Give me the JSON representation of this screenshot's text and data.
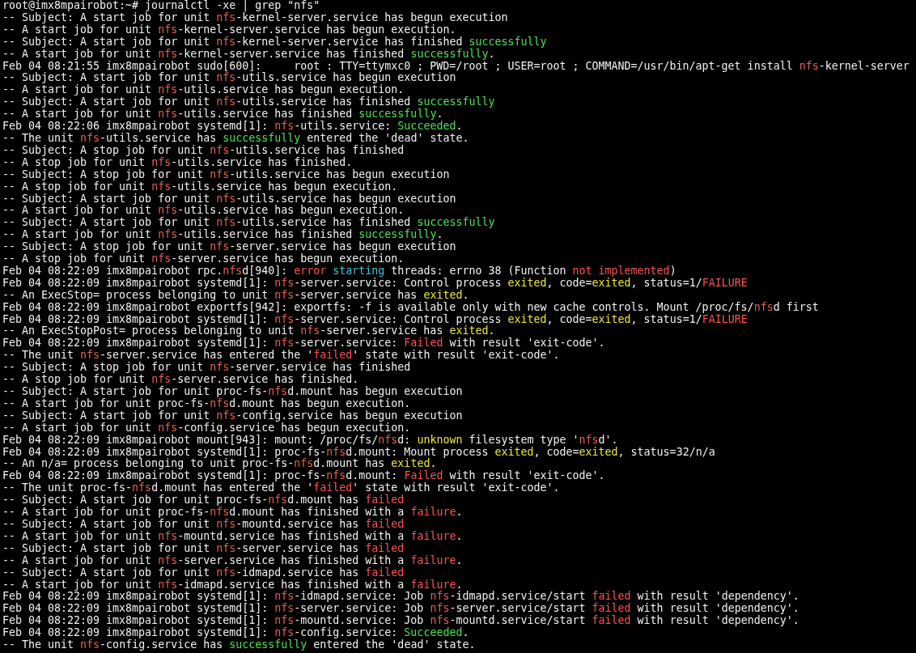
{
  "terminal": {
    "lines": [
      {
        "segments": [
          {
            "kind": "plain",
            "text": "root@imx8mpairobot:~# journalctl -xe | grep \"nfs\""
          }
        ]
      },
      {
        "segments": [
          {
            "kind": "plain",
            "text": "-- Subject: A start job for unit "
          },
          {
            "kind": "match",
            "text": "nfs"
          },
          {
            "kind": "plain",
            "text": "-kernel-server.service has begun execution"
          }
        ]
      },
      {
        "segments": [
          {
            "kind": "plain",
            "text": "-- A start job for unit "
          },
          {
            "kind": "match",
            "text": "nfs"
          },
          {
            "kind": "plain",
            "text": "-kernel-server.service has begun execution."
          }
        ]
      },
      {
        "segments": [
          {
            "kind": "plain",
            "text": "-- Subject: A start job for unit "
          },
          {
            "kind": "match",
            "text": "nfs"
          },
          {
            "kind": "plain",
            "text": "-kernel-server.service has finished "
          },
          {
            "kind": "good",
            "text": "successfully"
          }
        ]
      },
      {
        "segments": [
          {
            "kind": "plain",
            "text": "-- A start job for unit "
          },
          {
            "kind": "match",
            "text": "nfs"
          },
          {
            "kind": "plain",
            "text": "-kernel-server.service has finished "
          },
          {
            "kind": "good",
            "text": "successfully"
          },
          {
            "kind": "plain",
            "text": "."
          }
        ]
      },
      {
        "segments": [
          {
            "kind": "plain",
            "text": "Feb 04 08:21:55 imx8mpairobot sudo[600]:     root : TTY=ttymxc0 ; PWD=/root ; USER=root ; COMMAND=/usr/bin/apt-get install "
          },
          {
            "kind": "match",
            "text": "nfs"
          },
          {
            "kind": "plain",
            "text": "-kernel-server"
          }
        ]
      },
      {
        "segments": [
          {
            "kind": "plain",
            "text": "-- Subject: A start job for unit "
          },
          {
            "kind": "match",
            "text": "nfs"
          },
          {
            "kind": "plain",
            "text": "-utils.service has begun execution"
          }
        ]
      },
      {
        "segments": [
          {
            "kind": "plain",
            "text": "-- A start job for unit "
          },
          {
            "kind": "match",
            "text": "nfs"
          },
          {
            "kind": "plain",
            "text": "-utils.service has begun execution."
          }
        ]
      },
      {
        "segments": [
          {
            "kind": "plain",
            "text": "-- Subject: A start job for unit "
          },
          {
            "kind": "match",
            "text": "nfs"
          },
          {
            "kind": "plain",
            "text": "-utils.service has finished "
          },
          {
            "kind": "good",
            "text": "successfully"
          }
        ]
      },
      {
        "segments": [
          {
            "kind": "plain",
            "text": "-- A start job for unit "
          },
          {
            "kind": "match",
            "text": "nfs"
          },
          {
            "kind": "plain",
            "text": "-utils.service has finished "
          },
          {
            "kind": "good",
            "text": "successfully"
          },
          {
            "kind": "plain",
            "text": "."
          }
        ]
      },
      {
        "segments": [
          {
            "kind": "plain",
            "text": "Feb 04 08:22:06 imx8mpairobot systemd[1]: "
          },
          {
            "kind": "match",
            "text": "nfs"
          },
          {
            "kind": "plain",
            "text": "-utils.service: "
          },
          {
            "kind": "good",
            "text": "Succeeded"
          },
          {
            "kind": "plain",
            "text": "."
          }
        ]
      },
      {
        "segments": [
          {
            "kind": "plain",
            "text": "-- The unit "
          },
          {
            "kind": "match",
            "text": "nfs"
          },
          {
            "kind": "plain",
            "text": "-utils.service has "
          },
          {
            "kind": "good",
            "text": "successfully"
          },
          {
            "kind": "plain",
            "text": " entered the 'dead' state."
          }
        ]
      },
      {
        "segments": [
          {
            "kind": "plain",
            "text": "-- Subject: A stop job for unit "
          },
          {
            "kind": "match",
            "text": "nfs"
          },
          {
            "kind": "plain",
            "text": "-utils.service has finished"
          }
        ]
      },
      {
        "segments": [
          {
            "kind": "plain",
            "text": "-- A stop job for unit "
          },
          {
            "kind": "match",
            "text": "nfs"
          },
          {
            "kind": "plain",
            "text": "-utils.service has finished."
          }
        ]
      },
      {
        "segments": [
          {
            "kind": "plain",
            "text": "-- Subject: A stop job for unit "
          },
          {
            "kind": "match",
            "text": "nfs"
          },
          {
            "kind": "plain",
            "text": "-utils.service has begun execution"
          }
        ]
      },
      {
        "segments": [
          {
            "kind": "plain",
            "text": "-- A stop job for unit "
          },
          {
            "kind": "match",
            "text": "nfs"
          },
          {
            "kind": "plain",
            "text": "-utils.service has begun execution."
          }
        ]
      },
      {
        "segments": [
          {
            "kind": "plain",
            "text": "-- Subject: A start job for unit "
          },
          {
            "kind": "match",
            "text": "nfs"
          },
          {
            "kind": "plain",
            "text": "-utils.service has begun execution"
          }
        ]
      },
      {
        "segments": [
          {
            "kind": "plain",
            "text": "-- A start job for unit "
          },
          {
            "kind": "match",
            "text": "nfs"
          },
          {
            "kind": "plain",
            "text": "-utils.service has begun execution."
          }
        ]
      },
      {
        "segments": [
          {
            "kind": "plain",
            "text": "-- Subject: A start job for unit "
          },
          {
            "kind": "match",
            "text": "nfs"
          },
          {
            "kind": "plain",
            "text": "-utils.service has finished "
          },
          {
            "kind": "good",
            "text": "successfully"
          }
        ]
      },
      {
        "segments": [
          {
            "kind": "plain",
            "text": "-- A start job for unit "
          },
          {
            "kind": "match",
            "text": "nfs"
          },
          {
            "kind": "plain",
            "text": "-utils.service has finished "
          },
          {
            "kind": "good",
            "text": "successfully"
          },
          {
            "kind": "plain",
            "text": "."
          }
        ]
      },
      {
        "segments": [
          {
            "kind": "plain",
            "text": "-- Subject: A stop job for unit "
          },
          {
            "kind": "match",
            "text": "nfs"
          },
          {
            "kind": "plain",
            "text": "-server.service has begun execution"
          }
        ]
      },
      {
        "segments": [
          {
            "kind": "plain",
            "text": "-- A stop job for unit "
          },
          {
            "kind": "match",
            "text": "nfs"
          },
          {
            "kind": "plain",
            "text": "-server.service has begun execution."
          }
        ]
      },
      {
        "segments": [
          {
            "kind": "plain",
            "text": "Feb 04 08:22:09 imx8mpairobot rpc."
          },
          {
            "kind": "match",
            "text": "nfs"
          },
          {
            "kind": "plain",
            "text": "d[940]: "
          },
          {
            "kind": "bad",
            "text": "error "
          },
          {
            "kind": "note",
            "text": "starting"
          },
          {
            "kind": "plain",
            "text": " threads: errno 38 (Function "
          },
          {
            "kind": "bad",
            "text": "not implemented"
          },
          {
            "kind": "plain",
            "text": ")"
          }
        ]
      },
      {
        "segments": [
          {
            "kind": "plain",
            "text": "Feb 04 08:22:09 imx8mpairobot systemd[1]: "
          },
          {
            "kind": "match",
            "text": "nfs"
          },
          {
            "kind": "plain",
            "text": "-server.service: Control process "
          },
          {
            "kind": "warn",
            "text": "exited"
          },
          {
            "kind": "plain",
            "text": ", code="
          },
          {
            "kind": "warn",
            "text": "exited"
          },
          {
            "kind": "plain",
            "text": ", status=1/"
          },
          {
            "kind": "bad",
            "text": "FAILURE"
          }
        ]
      },
      {
        "segments": [
          {
            "kind": "plain",
            "text": "-- An ExecStop= process belonging to unit "
          },
          {
            "kind": "match",
            "text": "nfs"
          },
          {
            "kind": "plain",
            "text": "-server.service has "
          },
          {
            "kind": "warn",
            "text": "exited"
          },
          {
            "kind": "plain",
            "text": "."
          }
        ]
      },
      {
        "segments": [
          {
            "kind": "plain",
            "text": "Feb 04 08:22:09 imx8mpairobot exportfs[942]: exportfs: -f is available only with new cache controls. Mount /proc/fs/"
          },
          {
            "kind": "match",
            "text": "nfs"
          },
          {
            "kind": "plain",
            "text": "d first"
          }
        ]
      },
      {
        "segments": [
          {
            "kind": "plain",
            "text": "Feb 04 08:22:09 imx8mpairobot systemd[1]: "
          },
          {
            "kind": "match",
            "text": "nfs"
          },
          {
            "kind": "plain",
            "text": "-server.service: Control process "
          },
          {
            "kind": "warn",
            "text": "exited"
          },
          {
            "kind": "plain",
            "text": ", code="
          },
          {
            "kind": "warn",
            "text": "exited"
          },
          {
            "kind": "plain",
            "text": ", status=1/"
          },
          {
            "kind": "bad",
            "text": "FAILURE"
          }
        ]
      },
      {
        "segments": [
          {
            "kind": "plain",
            "text": "-- An ExecStopPost= process belonging to unit "
          },
          {
            "kind": "match",
            "text": "nfs"
          },
          {
            "kind": "plain",
            "text": "-server.service has "
          },
          {
            "kind": "warn",
            "text": "exited"
          },
          {
            "kind": "plain",
            "text": "."
          }
        ]
      },
      {
        "segments": [
          {
            "kind": "plain",
            "text": "Feb 04 08:22:09 imx8mpairobot systemd[1]: "
          },
          {
            "kind": "match",
            "text": "nfs"
          },
          {
            "kind": "plain",
            "text": "-server.service: "
          },
          {
            "kind": "bad",
            "text": "Failed"
          },
          {
            "kind": "plain",
            "text": " with result 'exit-code'."
          }
        ]
      },
      {
        "segments": [
          {
            "kind": "plain",
            "text": "-- The unit "
          },
          {
            "kind": "match",
            "text": "nfs"
          },
          {
            "kind": "plain",
            "text": "-server.service has entered the '"
          },
          {
            "kind": "bad",
            "text": "failed"
          },
          {
            "kind": "plain",
            "text": "' state with result 'exit-code'."
          }
        ]
      },
      {
        "segments": [
          {
            "kind": "plain",
            "text": "-- Subject: A stop job for unit "
          },
          {
            "kind": "match",
            "text": "nfs"
          },
          {
            "kind": "plain",
            "text": "-server.service has finished"
          }
        ]
      },
      {
        "segments": [
          {
            "kind": "plain",
            "text": "-- A stop job for unit "
          },
          {
            "kind": "match",
            "text": "nfs"
          },
          {
            "kind": "plain",
            "text": "-server.service has finished."
          }
        ]
      },
      {
        "segments": [
          {
            "kind": "plain",
            "text": "-- Subject: A start job for unit proc-fs-"
          },
          {
            "kind": "match",
            "text": "nfs"
          },
          {
            "kind": "plain",
            "text": "d.mount has begun execution"
          }
        ]
      },
      {
        "segments": [
          {
            "kind": "plain",
            "text": "-- A start job for unit proc-fs-"
          },
          {
            "kind": "match",
            "text": "nfs"
          },
          {
            "kind": "plain",
            "text": "d.mount has begun execution."
          }
        ]
      },
      {
        "segments": [
          {
            "kind": "plain",
            "text": "-- Subject: A start job for unit "
          },
          {
            "kind": "match",
            "text": "nfs"
          },
          {
            "kind": "plain",
            "text": "-config.service has begun execution"
          }
        ]
      },
      {
        "segments": [
          {
            "kind": "plain",
            "text": "-- A start job for unit "
          },
          {
            "kind": "match",
            "text": "nfs"
          },
          {
            "kind": "plain",
            "text": "-config.service has begun execution."
          }
        ]
      },
      {
        "segments": [
          {
            "kind": "plain",
            "text": "Feb 04 08:22:09 imx8mpairobot mount[943]: mount: /proc/fs/"
          },
          {
            "kind": "match",
            "text": "nfs"
          },
          {
            "kind": "plain",
            "text": "d: "
          },
          {
            "kind": "warn",
            "text": "unknown"
          },
          {
            "kind": "plain",
            "text": " filesystem type '"
          },
          {
            "kind": "match",
            "text": "nfs"
          },
          {
            "kind": "plain",
            "text": "d'."
          }
        ]
      },
      {
        "segments": [
          {
            "kind": "plain",
            "text": "Feb 04 08:22:09 imx8mpairobot systemd[1]: proc-fs-"
          },
          {
            "kind": "match",
            "text": "nfs"
          },
          {
            "kind": "plain",
            "text": "d.mount: Mount process "
          },
          {
            "kind": "warn",
            "text": "exited"
          },
          {
            "kind": "plain",
            "text": ", code="
          },
          {
            "kind": "warn",
            "text": "exited"
          },
          {
            "kind": "plain",
            "text": ", status=32/n/a"
          }
        ]
      },
      {
        "segments": [
          {
            "kind": "plain",
            "text": "-- An n/a= process belonging to unit proc-fs-"
          },
          {
            "kind": "match",
            "text": "nfs"
          },
          {
            "kind": "plain",
            "text": "d.mount has "
          },
          {
            "kind": "warn",
            "text": "exited"
          },
          {
            "kind": "plain",
            "text": "."
          }
        ]
      },
      {
        "segments": [
          {
            "kind": "plain",
            "text": "Feb 04 08:22:09 imx8mpairobot systemd[1]: proc-fs-"
          },
          {
            "kind": "match",
            "text": "nfs"
          },
          {
            "kind": "plain",
            "text": "d.mount: "
          },
          {
            "kind": "bad",
            "text": "Failed"
          },
          {
            "kind": "plain",
            "text": " with result 'exit-code'."
          }
        ]
      },
      {
        "segments": [
          {
            "kind": "plain",
            "text": "-- The unit proc-fs-"
          },
          {
            "kind": "match",
            "text": "nfs"
          },
          {
            "kind": "plain",
            "text": "d.mount has entered the '"
          },
          {
            "kind": "bad",
            "text": "failed"
          },
          {
            "kind": "plain",
            "text": "' state with result 'exit-code'."
          }
        ]
      },
      {
        "segments": [
          {
            "kind": "plain",
            "text": "-- Subject: A start job for unit proc-fs-"
          },
          {
            "kind": "match",
            "text": "nfs"
          },
          {
            "kind": "plain",
            "text": "d.mount has "
          },
          {
            "kind": "bad",
            "text": "failed"
          }
        ]
      },
      {
        "segments": [
          {
            "kind": "plain",
            "text": "-- A start job for unit proc-fs-"
          },
          {
            "kind": "match",
            "text": "nfs"
          },
          {
            "kind": "plain",
            "text": "d.mount has finished with a "
          },
          {
            "kind": "bad",
            "text": "failure"
          },
          {
            "kind": "plain",
            "text": "."
          }
        ]
      },
      {
        "segments": [
          {
            "kind": "plain",
            "text": "-- Subject: A start job for unit "
          },
          {
            "kind": "match",
            "text": "nfs"
          },
          {
            "kind": "plain",
            "text": "-mountd.service has "
          },
          {
            "kind": "bad",
            "text": "failed"
          }
        ]
      },
      {
        "segments": [
          {
            "kind": "plain",
            "text": "-- A start job for unit "
          },
          {
            "kind": "match",
            "text": "nfs"
          },
          {
            "kind": "plain",
            "text": "-mountd.service has finished with a "
          },
          {
            "kind": "bad",
            "text": "failure"
          },
          {
            "kind": "plain",
            "text": "."
          }
        ]
      },
      {
        "segments": [
          {
            "kind": "plain",
            "text": "-- Subject: A start job for unit "
          },
          {
            "kind": "match",
            "text": "nfs"
          },
          {
            "kind": "plain",
            "text": "-server.service has "
          },
          {
            "kind": "bad",
            "text": "failed"
          }
        ]
      },
      {
        "segments": [
          {
            "kind": "plain",
            "text": "-- A start job for unit "
          },
          {
            "kind": "match",
            "text": "nfs"
          },
          {
            "kind": "plain",
            "text": "-server.service has finished with a "
          },
          {
            "kind": "bad",
            "text": "failure"
          },
          {
            "kind": "plain",
            "text": "."
          }
        ]
      },
      {
        "segments": [
          {
            "kind": "plain",
            "text": "-- Subject: A start job for unit "
          },
          {
            "kind": "match",
            "text": "nfs"
          },
          {
            "kind": "plain",
            "text": "-idmapd.service has "
          },
          {
            "kind": "bad",
            "text": "failed"
          }
        ]
      },
      {
        "segments": [
          {
            "kind": "plain",
            "text": "-- A start job for unit "
          },
          {
            "kind": "match",
            "text": "nfs"
          },
          {
            "kind": "plain",
            "text": "-idmapd.service has finished with a "
          },
          {
            "kind": "bad",
            "text": "failure"
          },
          {
            "kind": "plain",
            "text": "."
          }
        ]
      },
      {
        "segments": [
          {
            "kind": "plain",
            "text": "Feb 04 08:22:09 imx8mpairobot systemd[1]: "
          },
          {
            "kind": "match",
            "text": "nfs"
          },
          {
            "kind": "plain",
            "text": "-idmapd.service: Job "
          },
          {
            "kind": "match",
            "text": "nfs"
          },
          {
            "kind": "plain",
            "text": "-idmapd.service/start "
          },
          {
            "kind": "bad",
            "text": "failed"
          },
          {
            "kind": "plain",
            "text": " with result 'dependency'."
          }
        ]
      },
      {
        "segments": [
          {
            "kind": "plain",
            "text": "Feb 04 08:22:09 imx8mpairobot systemd[1]: "
          },
          {
            "kind": "match",
            "text": "nfs"
          },
          {
            "kind": "plain",
            "text": "-server.service: Job "
          },
          {
            "kind": "match",
            "text": "nfs"
          },
          {
            "kind": "plain",
            "text": "-server.service/start "
          },
          {
            "kind": "bad",
            "text": "failed"
          },
          {
            "kind": "plain",
            "text": " with result 'dependency'."
          }
        ]
      },
      {
        "segments": [
          {
            "kind": "plain",
            "text": "Feb 04 08:22:09 imx8mpairobot systemd[1]: "
          },
          {
            "kind": "match",
            "text": "nfs"
          },
          {
            "kind": "plain",
            "text": "-mountd.service: Job "
          },
          {
            "kind": "match",
            "text": "nfs"
          },
          {
            "kind": "plain",
            "text": "-mountd.service/start "
          },
          {
            "kind": "bad",
            "text": "failed"
          },
          {
            "kind": "plain",
            "text": " with result 'dependency'."
          }
        ]
      },
      {
        "segments": [
          {
            "kind": "plain",
            "text": "Feb 04 08:22:09 imx8mpairobot systemd[1]: "
          },
          {
            "kind": "match",
            "text": "nfs"
          },
          {
            "kind": "plain",
            "text": "-config.service: "
          },
          {
            "kind": "good",
            "text": "Succeeded"
          },
          {
            "kind": "plain",
            "text": "."
          }
        ]
      },
      {
        "segments": [
          {
            "kind": "plain",
            "text": "-- The unit "
          },
          {
            "kind": "match",
            "text": "nfs"
          },
          {
            "kind": "plain",
            "text": "-config.service has "
          },
          {
            "kind": "good",
            "text": "successfully"
          },
          {
            "kind": "plain",
            "text": " entered the 'dead' state."
          }
        ]
      }
    ]
  }
}
